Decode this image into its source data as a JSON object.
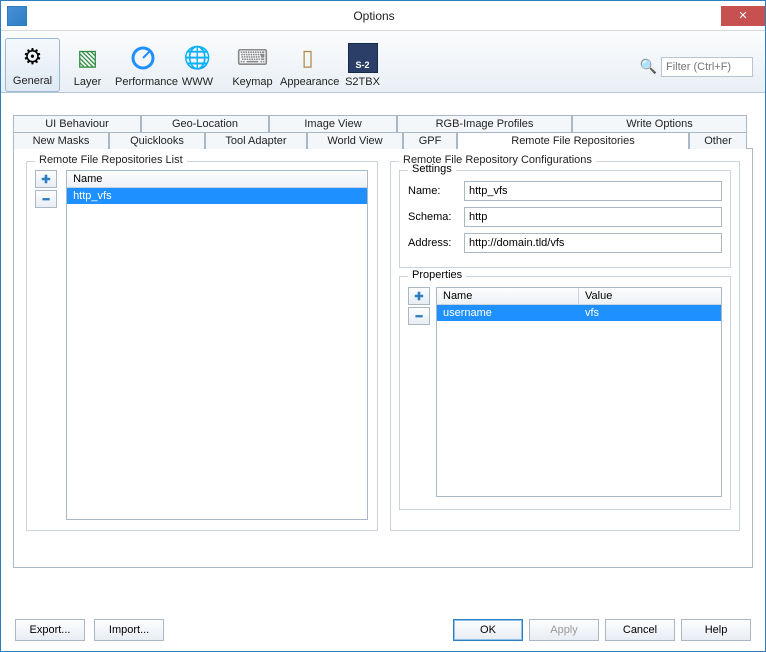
{
  "window": {
    "title": "Options"
  },
  "search": {
    "placeholder": "Filter (Ctrl+F)"
  },
  "categories": [
    {
      "id": "general",
      "label": "General",
      "active": true
    },
    {
      "id": "layer",
      "label": "Layer"
    },
    {
      "id": "performance",
      "label": "Performance"
    },
    {
      "id": "www",
      "label": "WWW"
    },
    {
      "id": "keymap",
      "label": "Keymap"
    },
    {
      "id": "appearance",
      "label": "Appearance"
    },
    {
      "id": "s2tbx",
      "label": "S2TBX"
    }
  ],
  "tabs_row1": [
    "UI Behaviour",
    "Geo-Location",
    "Image View",
    "RGB-Image Profiles",
    "Write Options"
  ],
  "tabs_row2": [
    "New Masks",
    "Quicklooks",
    "Tool Adapter",
    "World View",
    "GPF",
    "Remote File Repositories",
    "Other"
  ],
  "active_tab": "Remote File Repositories",
  "repo_list": {
    "title": "Remote File Repositories List",
    "header": "Name",
    "items": [
      "http_vfs"
    ],
    "selected": 0
  },
  "config": {
    "title": "Remote File Repository Configurations",
    "settings_title": "Settings",
    "fields": {
      "name_label": "Name:",
      "name_value": "http_vfs",
      "schema_label": "Schema:",
      "schema_value": "http",
      "address_label": "Address:",
      "address_value": "http://domain.tld/vfs"
    },
    "properties_title": "Properties",
    "prop_headers": {
      "name": "Name",
      "value": "Value"
    },
    "prop_rows": [
      {
        "name": "username",
        "value": "vfs"
      }
    ],
    "prop_selected": 0
  },
  "buttons": {
    "export": "Export...",
    "import": "Import...",
    "ok": "OK",
    "apply": "Apply",
    "cancel": "Cancel",
    "help": "Help"
  }
}
